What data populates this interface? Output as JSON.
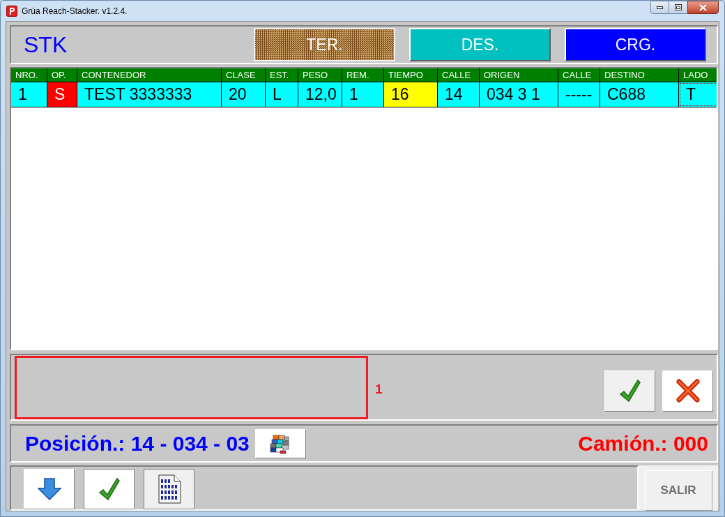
{
  "window": {
    "title": "Grúa Reach-Stacker. v1.2.4."
  },
  "header": {
    "label": "STK",
    "modes": [
      {
        "label": "TER.",
        "kind": "hatched",
        "selected": true
      },
      {
        "label": "DES.",
        "kind": "teal",
        "selected": false
      },
      {
        "label": "CRG.",
        "kind": "blue",
        "selected": false
      }
    ]
  },
  "table": {
    "columns": [
      "NRO.",
      "OP.",
      "CONTENEDOR",
      "CLASE",
      "EST.",
      "PESO",
      "REM.",
      "TIEMPO",
      "CALLE",
      "ORIGEN",
      "CALLE",
      "DESTINO",
      "LADO"
    ],
    "rows": [
      {
        "cells": [
          {
            "text": "1",
            "focused": false
          },
          {
            "text": "S",
            "color": "#ff0000",
            "focused": false
          },
          {
            "text": "TEST 3333333",
            "focused": false
          },
          {
            "text": "20",
            "focused": false
          },
          {
            "text": "L",
            "focused": false
          },
          {
            "text": "12,0",
            "focused": false
          },
          {
            "text": "1",
            "focused": false
          },
          {
            "text": "16",
            "color": "#ffff00",
            "focused": false
          },
          {
            "text": "14",
            "focused": false
          },
          {
            "text": "034 3 1",
            "focused": false
          },
          {
            "text": "-----",
            "focused": false
          },
          {
            "text": "C688",
            "focused": false
          },
          {
            "text": "T",
            "focused": true
          }
        ]
      }
    ]
  },
  "message": {
    "count": "1"
  },
  "position": {
    "label": "Posición.: 14 - 034 - 03",
    "truck": "Camión.: 000"
  },
  "footer": {
    "exit_button": "SALIR"
  }
}
